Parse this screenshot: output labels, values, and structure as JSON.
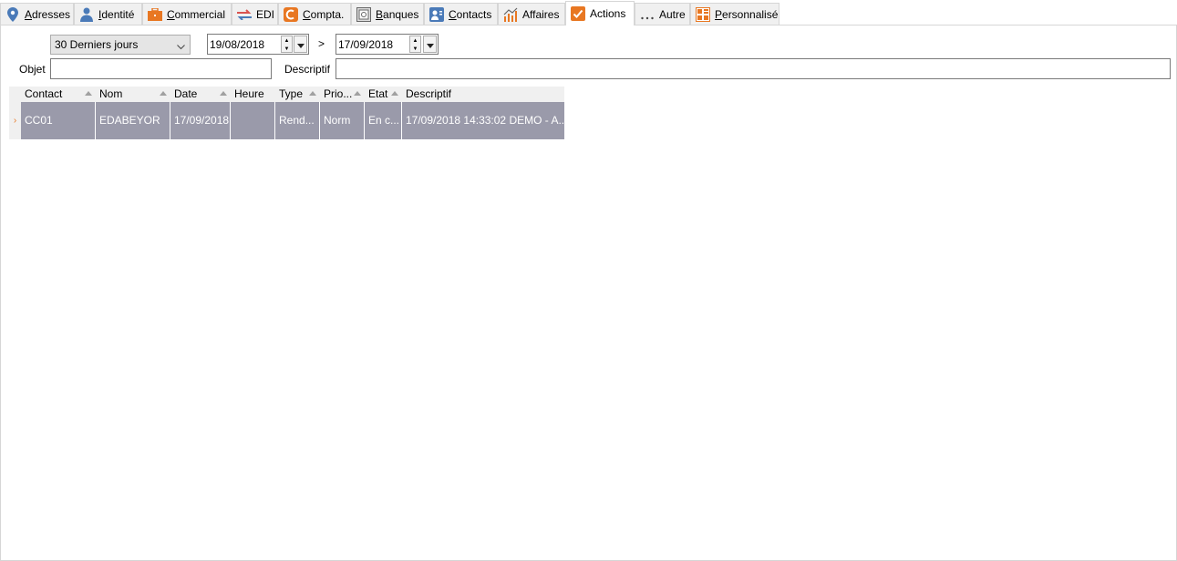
{
  "tabs": [
    {
      "label": "Adresses",
      "access": "A",
      "rest": "dresses",
      "icon": "location-pin-icon",
      "active": false
    },
    {
      "label": "Identité",
      "access": "I",
      "rest": "dentité",
      "icon": "person-icon",
      "active": false
    },
    {
      "label": "Commercial",
      "access": "C",
      "rest": "ommercial",
      "icon": "briefcase-icon",
      "active": false
    },
    {
      "label": "EDI",
      "access": "",
      "rest": "EDI",
      "icon": "exchange-arrows-icon",
      "active": false
    },
    {
      "label": "Compta.",
      "access": "C",
      "rest": "ompta.",
      "icon": "accounting-icon",
      "active": false
    },
    {
      "label": "Banques",
      "access": "B",
      "rest": "anques",
      "icon": "safe-icon",
      "active": false
    },
    {
      "label": "Contacts",
      "access": "C",
      "rest": "ontacts",
      "icon": "contact-card-icon",
      "active": false
    },
    {
      "label": "Affaires",
      "access": "",
      "rest": "Affaires",
      "icon": "chart-growth-icon",
      "active": false
    },
    {
      "label": "Actions",
      "access": "",
      "rest": "Actions",
      "icon": "checkbox-icon",
      "active": true
    },
    {
      "label": "Autre",
      "access": "",
      "rest": "Autre",
      "icon": "ellipsis-icon",
      "active": false
    },
    {
      "label": "Personnalisé",
      "access": "P",
      "rest": "ersonnalisé",
      "icon": "custom-grid-icon",
      "active": false
    }
  ],
  "filters": {
    "period": "30 Derniers jours",
    "date_from": "19/08/2018",
    "separator": ">",
    "date_to": "17/09/2018",
    "objet_label": "Objet",
    "objet_value": "",
    "descriptif_label": "Descriptif",
    "descriptif_value": ""
  },
  "grid": {
    "columns": [
      "Contact",
      "Nom",
      "Date",
      "Heure",
      "Type",
      "Prio...",
      "Etat",
      "Descriptif"
    ],
    "rows": [
      [
        "CC01",
        "EDABEYOR",
        "17/09/2018",
        "",
        "Rend...",
        "Norm",
        "En c...",
        "17/09/2018 14:33:02 DEMO - A..."
      ]
    ]
  },
  "colors": {
    "accent": "#e87722",
    "selected_row": "#9a9aaa",
    "tab_bg": "#f0f0f0"
  }
}
